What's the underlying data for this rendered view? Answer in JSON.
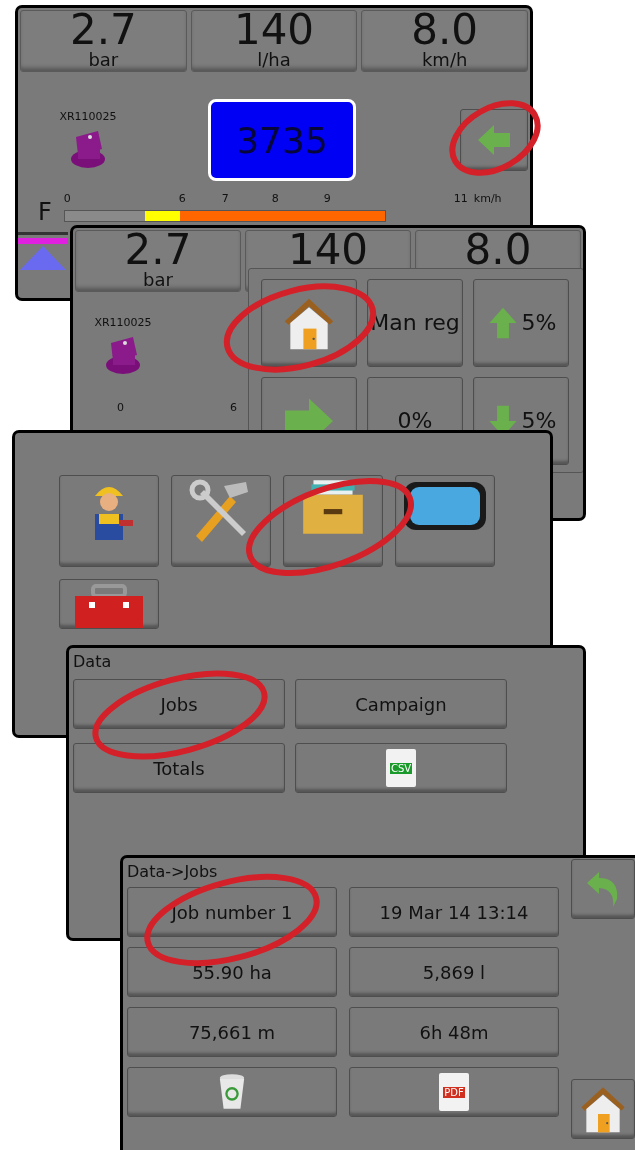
{
  "run_screen": {
    "readouts": [
      {
        "value": "2.7",
        "unit": "bar"
      },
      {
        "value": "140",
        "unit": "l/ha"
      },
      {
        "value": "8.0",
        "unit": "km/h"
      }
    ],
    "nozzle": "XR110025",
    "count": "3735",
    "section_label": "F",
    "scale": [
      "0",
      "6",
      "7",
      "8",
      "9",
      "11"
    ],
    "scale_unit": "km/h"
  },
  "run_screen_menu": {
    "readouts": [
      {
        "value": "2.7",
        "unit": "bar"
      },
      {
        "value": "140"
      },
      {
        "value": "8.0"
      }
    ],
    "nozzle": "XR110025",
    "scale": [
      "0",
      "6"
    ],
    "menu": [
      {
        "kind": "home"
      },
      {
        "kind": "text",
        "label": "Man reg"
      },
      {
        "kind": "up",
        "label": "5%"
      },
      {
        "kind": "right"
      },
      {
        "kind": "text",
        "label": "0%"
      },
      {
        "kind": "down",
        "label": "5%"
      }
    ]
  },
  "main_menu": {
    "items": [
      {
        "kind": "worker"
      },
      {
        "kind": "tools"
      },
      {
        "kind": "drawer"
      },
      {
        "kind": "screen"
      },
      {
        "kind": "toolbox"
      }
    ]
  },
  "data_menu": {
    "title": "Data",
    "buttons": [
      {
        "kind": "text",
        "label": "Jobs"
      },
      {
        "kind": "text",
        "label": "Campaign"
      },
      {
        "kind": "text",
        "label": "Totals"
      },
      {
        "kind": "file",
        "label": "CSV"
      }
    ]
  },
  "jobs_screen": {
    "title": "Data->Jobs",
    "cells": [
      {
        "kind": "text",
        "label": "Job number 1"
      },
      {
        "kind": "text",
        "label": "19 Mar 14 13:14"
      },
      {
        "kind": "text",
        "label": "55.90 ha"
      },
      {
        "kind": "text",
        "label": "5,869 l"
      },
      {
        "kind": "text",
        "label": "75,661 m"
      },
      {
        "kind": "text",
        "label": "6h 48m"
      },
      {
        "kind": "bin"
      },
      {
        "kind": "file",
        "label": "PDF"
      }
    ]
  }
}
